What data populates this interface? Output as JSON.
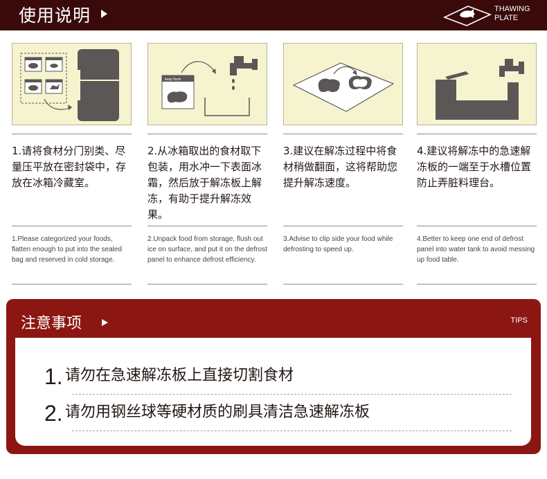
{
  "header": {
    "title": "使用说明",
    "brand_line1": "THAWING",
    "brand_line2": "PLATE"
  },
  "steps": [
    {
      "zh": "1.请将食材分门别类、尽量压平放在密封袋中，存放在冰箱冷藏室。",
      "en": "1.Please categorized your foods, flatten enough to put into the sealed bag and reserved in cold storage."
    },
    {
      "zh": "2.从冰箱取出的食材取下包装，用水冲一下表面冰霜，然后放于解冻板上解冻，有助于提升解冻效果。",
      "en": "2.Unpack food from storage, flush out ice on surface, and put it on the defrost panel to enhance defrost efficiency.",
      "bag_label": "keep fresh"
    },
    {
      "zh": "3.建议在解冻过程中将食材稍做翻面，这将帮助您提升解冻速度。",
      "en": "3.Advise to clip side your food while defrosting to speed up."
    },
    {
      "zh": "4.建议将解冻中的急速解冻板的一端至于水槽位置防止弄脏料理台。",
      "en": "4.Better to keep one end of defrost panel into water tank to avoid messing up food table."
    }
  ],
  "notice": {
    "title": "注意事项",
    "tips": "TIPS",
    "items": [
      {
        "num": "1.",
        "text": "请勿在急速解冻板上直接切割食材"
      },
      {
        "num": "2.",
        "text": "请勿用钢丝球等硬材质的刷具清洁急速解冻板"
      }
    ]
  },
  "colors": {
    "header_bg": "#3a0a0a",
    "notice_bg": "#8c1612",
    "panel_bg": "#f6f3cf",
    "icon_gray": "#5a5756"
  }
}
